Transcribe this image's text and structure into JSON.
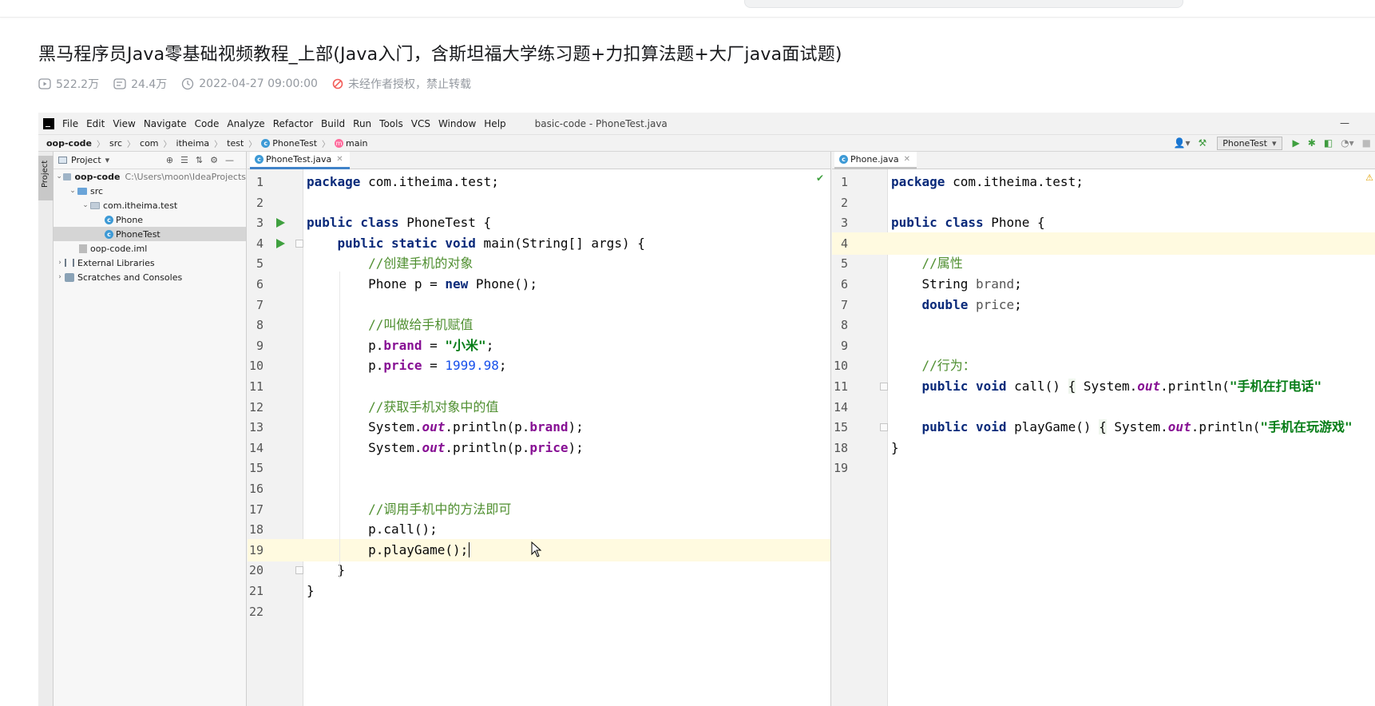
{
  "video": {
    "title": "黑马程序员Java零基础视频教程_上部(Java入门，含斯坦福大学练习题+力扣算法题+大厂java面试题)",
    "views": "522.2万",
    "danmaku": "24.4万",
    "date": "2022-04-27 09:00:00",
    "copyright": "未经作者授权，禁止转载"
  },
  "ide": {
    "menu": [
      "File",
      "Edit",
      "View",
      "Navigate",
      "Code",
      "Analyze",
      "Refactor",
      "Build",
      "Run",
      "Tools",
      "VCS",
      "Window",
      "Help"
    ],
    "window_title": "basic-code - PhoneTest.java",
    "breadcrumb": [
      "oop-code",
      "src",
      "com",
      "itheima",
      "test",
      "PhoneTest",
      "main"
    ],
    "run_config": "PhoneTest",
    "sidebar_tab": "Project",
    "project_header": "Project",
    "tree": {
      "root": "oop-code",
      "root_path": "C:\\Users\\moon\\IdeaProjects",
      "src": "src",
      "package": "com.itheima.test",
      "class1": "Phone",
      "class2": "PhoneTest",
      "iml": "oop-code.iml",
      "libs": "External Libraries",
      "scratches": "Scratches and Consoles"
    },
    "left_editor": {
      "tab": "PhoneTest.java",
      "line_numbers": [
        "1",
        "2",
        "3",
        "4",
        "5",
        "6",
        "7",
        "8",
        "9",
        "10",
        "11",
        "12",
        "13",
        "14",
        "15",
        "16",
        "17",
        "18",
        "19",
        "20",
        "21",
        "22"
      ]
    },
    "right_editor": {
      "tab": "Phone.java",
      "line_numbers": [
        "1",
        "2",
        "3",
        "4",
        "5",
        "6",
        "7",
        "8",
        "9",
        "10",
        "11",
        "14",
        "15",
        "18",
        "19"
      ]
    }
  }
}
